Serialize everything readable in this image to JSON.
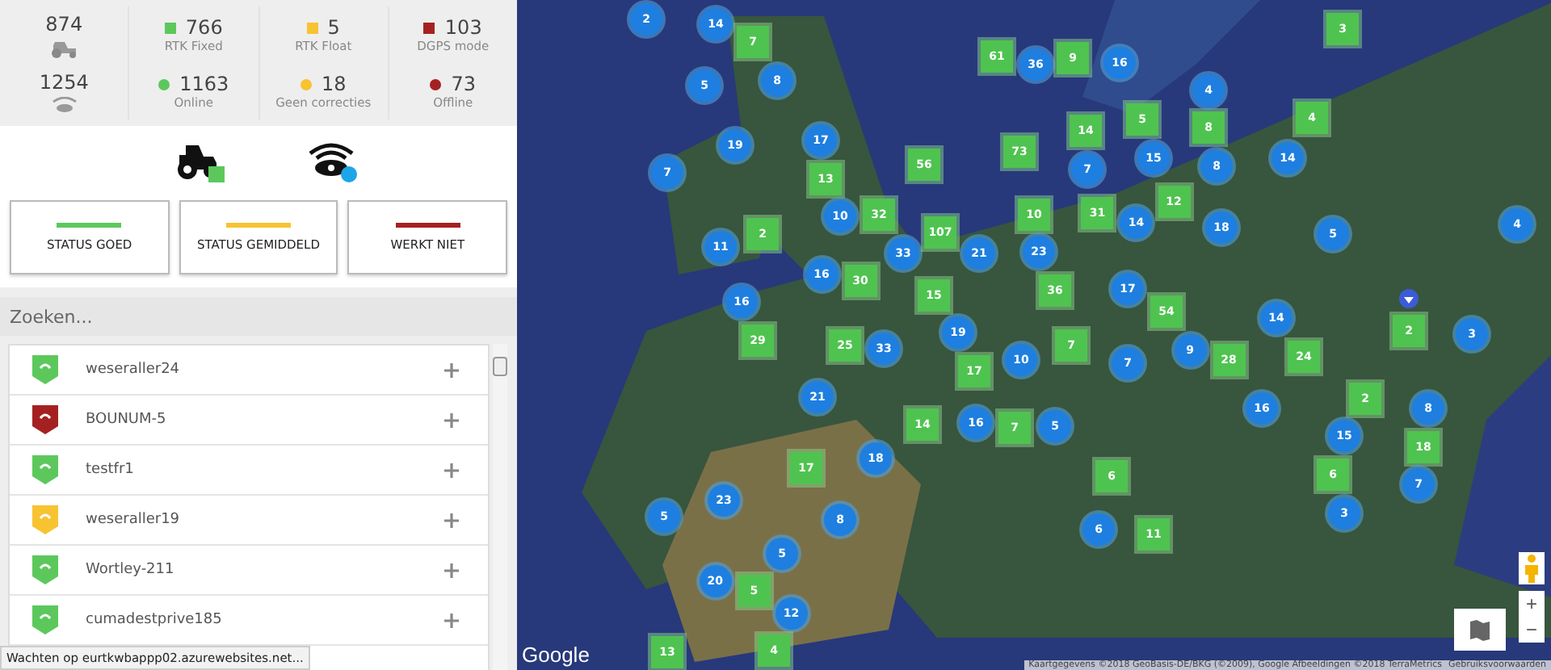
{
  "stats": [
    {
      "kind": "vehicles",
      "total": "874",
      "legend": [
        {
          "value": "766",
          "label": "RTK Fixed",
          "color": "#5cc85c"
        },
        {
          "value": "5",
          "label": "RTK Float",
          "color": "#f7c331"
        },
        {
          "value": "103",
          "label": "DGPS mode",
          "color": "#a52121"
        }
      ]
    },
    {
      "kind": "stations",
      "total": "1254",
      "legend": [
        {
          "value": "1163",
          "label": "Online",
          "color": "#5cc85c"
        },
        {
          "value": "18",
          "label": "Geen correcties",
          "color": "#f7c331"
        },
        {
          "value": "73",
          "label": "Offline",
          "color": "#a52121"
        }
      ]
    }
  ],
  "status_buttons": [
    {
      "label": "STATUS GOED",
      "color": "#5cc85c"
    },
    {
      "label": "STATUS GEMIDDELD",
      "color": "#f7c331"
    },
    {
      "label": "WERKT NIET",
      "color": "#a52121"
    }
  ],
  "search": {
    "placeholder": "Zoeken..."
  },
  "devices": [
    {
      "name": "weseraller24",
      "color": "#5cc85c"
    },
    {
      "name": "BOUNUM-5",
      "color": "#a52121"
    },
    {
      "name": "testfr1",
      "color": "#5cc85c"
    },
    {
      "name": "weseraller19",
      "color": "#f7c331"
    },
    {
      "name": "Wortley-211",
      "color": "#5cc85c"
    },
    {
      "name": "cumadestprive185",
      "color": "#5cc85c"
    }
  ],
  "browser_status": "Wachten op eurtkwbappp02.azurewebsites.net...",
  "map": {
    "markers": [
      {
        "kind": "station",
        "count": "2"
      },
      {
        "kind": "station",
        "count": "14"
      },
      {
        "kind": "vehicle",
        "count": "7"
      },
      {
        "kind": "station",
        "count": "5"
      },
      {
        "kind": "station",
        "count": "8"
      },
      {
        "kind": "station",
        "count": "19"
      },
      {
        "kind": "station",
        "count": "7"
      },
      {
        "kind": "station",
        "count": "17"
      },
      {
        "kind": "vehicle",
        "count": "13"
      },
      {
        "kind": "vehicle",
        "count": "56"
      },
      {
        "kind": "station",
        "count": "10"
      },
      {
        "kind": "vehicle",
        "count": "32"
      },
      {
        "kind": "vehicle",
        "count": "2"
      },
      {
        "kind": "station",
        "count": "11"
      },
      {
        "kind": "station",
        "count": "16"
      },
      {
        "kind": "vehicle",
        "count": "30"
      },
      {
        "kind": "station",
        "count": "33"
      },
      {
        "kind": "vehicle",
        "count": "107"
      },
      {
        "kind": "station",
        "count": "21"
      },
      {
        "kind": "vehicle",
        "count": "15"
      },
      {
        "kind": "station",
        "count": "16"
      },
      {
        "kind": "vehicle",
        "count": "29"
      },
      {
        "kind": "vehicle",
        "count": "61"
      },
      {
        "kind": "station",
        "count": "36"
      },
      {
        "kind": "vehicle",
        "count": "9"
      },
      {
        "kind": "station",
        "count": "16"
      },
      {
        "kind": "vehicle",
        "count": "73"
      },
      {
        "kind": "vehicle",
        "count": "10"
      },
      {
        "kind": "station",
        "count": "23"
      },
      {
        "kind": "vehicle",
        "count": "36"
      },
      {
        "kind": "vehicle",
        "count": "14"
      },
      {
        "kind": "station",
        "count": "7"
      },
      {
        "kind": "vehicle",
        "count": "5"
      },
      {
        "kind": "station",
        "count": "15"
      },
      {
        "kind": "vehicle",
        "count": "8"
      },
      {
        "kind": "station",
        "count": "8"
      },
      {
        "kind": "station",
        "count": "4"
      },
      {
        "kind": "station",
        "count": "14"
      },
      {
        "kind": "vehicle",
        "count": "4"
      },
      {
        "kind": "vehicle",
        "count": "3"
      },
      {
        "kind": "vehicle",
        "count": "31"
      },
      {
        "kind": "station",
        "count": "14"
      },
      {
        "kind": "vehicle",
        "count": "12"
      },
      {
        "kind": "station",
        "count": "18"
      },
      {
        "kind": "station",
        "count": "5"
      },
      {
        "kind": "station",
        "count": "4"
      },
      {
        "kind": "station",
        "count": "17"
      },
      {
        "kind": "vehicle",
        "count": "54"
      },
      {
        "kind": "station",
        "count": "19"
      },
      {
        "kind": "vehicle",
        "count": "25"
      },
      {
        "kind": "station",
        "count": "33"
      },
      {
        "kind": "vehicle",
        "count": "17"
      },
      {
        "kind": "station",
        "count": "10"
      },
      {
        "kind": "vehicle",
        "count": "7"
      },
      {
        "kind": "station",
        "count": "7"
      },
      {
        "kind": "station",
        "count": "9"
      },
      {
        "kind": "vehicle",
        "count": "28"
      },
      {
        "kind": "vehicle",
        "count": "24"
      },
      {
        "kind": "station",
        "count": "14"
      },
      {
        "kind": "vehicle",
        "count": "2"
      },
      {
        "kind": "station",
        "count": "3"
      },
      {
        "kind": "station",
        "count": "21"
      },
      {
        "kind": "vehicle",
        "count": "14"
      },
      {
        "kind": "station",
        "count": "16"
      },
      {
        "kind": "vehicle",
        "count": "7"
      },
      {
        "kind": "station",
        "count": "5"
      },
      {
        "kind": "station",
        "count": "18"
      },
      {
        "kind": "vehicle",
        "count": "17"
      },
      {
        "kind": "station",
        "count": "16"
      },
      {
        "kind": "vehicle",
        "count": "2"
      },
      {
        "kind": "station",
        "count": "15"
      },
      {
        "kind": "vehicle",
        "count": "6"
      },
      {
        "kind": "station",
        "count": "8"
      },
      {
        "kind": "vehicle",
        "count": "18"
      },
      {
        "kind": "station",
        "count": "7"
      },
      {
        "kind": "station",
        "count": "3"
      },
      {
        "kind": "vehicle",
        "count": "6"
      },
      {
        "kind": "station",
        "count": "6"
      },
      {
        "kind": "vehicle",
        "count": "11"
      },
      {
        "kind": "station",
        "count": "5"
      },
      {
        "kind": "station",
        "count": "23"
      },
      {
        "kind": "station",
        "count": "8"
      },
      {
        "kind": "station",
        "count": "5"
      },
      {
        "kind": "station",
        "count": "20"
      },
      {
        "kind": "vehicle",
        "count": "5"
      },
      {
        "kind": "station",
        "count": "12"
      },
      {
        "kind": "vehicle",
        "count": "13"
      },
      {
        "kind": "vehicle",
        "count": "4"
      }
    ],
    "logo": "Google",
    "attribution": "Kaartgegevens ©2018 GeoBasis-DE/BKG (©2009), Google Afbeeldingen ©2018 TerraMetrics",
    "terms": "Gebruiksvoorwaarden",
    "zoom_in": "+",
    "zoom_out": "−"
  }
}
